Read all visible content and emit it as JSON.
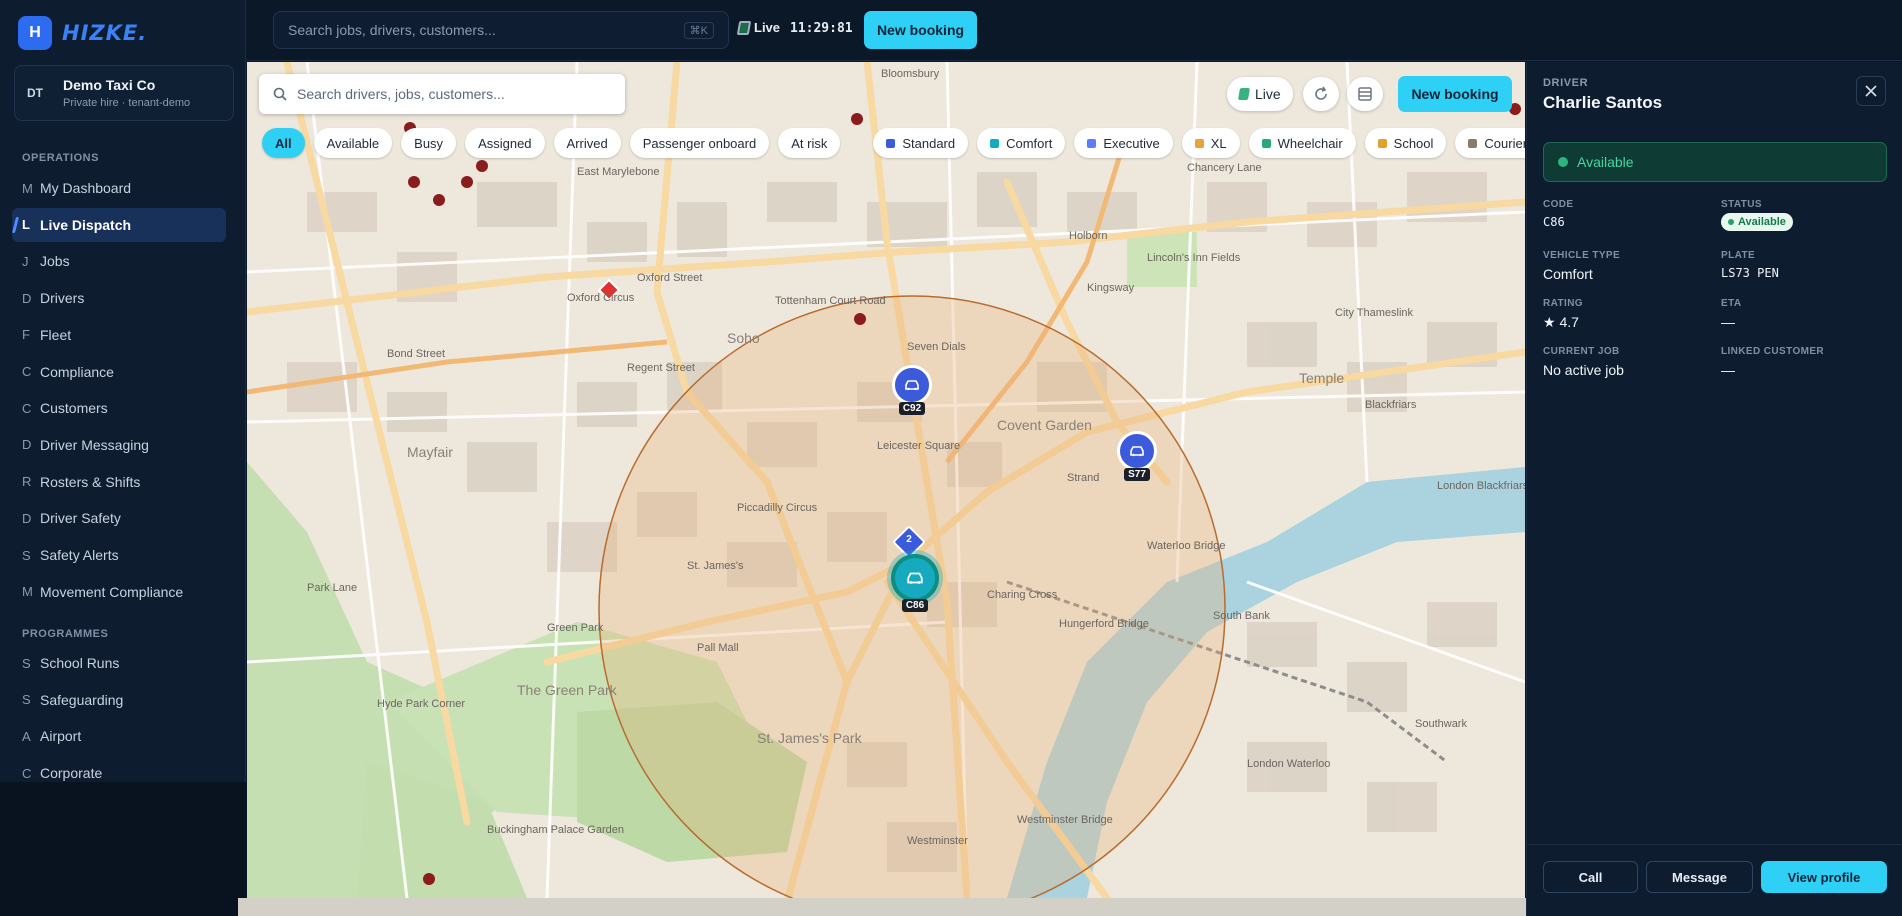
{
  "brand": {
    "mark": "H",
    "name": "HIZKE."
  },
  "tenant": {
    "initials": "DT",
    "name": "Demo Taxi Co",
    "subtitle": "Private hire · tenant-demo"
  },
  "nav": {
    "operations_label": "OPERATIONS",
    "operations": [
      {
        "letter": "M",
        "label": "My Dashboard"
      },
      {
        "letter": "L",
        "label": "Live Dispatch",
        "active": true
      },
      {
        "letter": "J",
        "label": "Jobs"
      },
      {
        "letter": "D",
        "label": "Drivers"
      },
      {
        "letter": "F",
        "label": "Fleet"
      },
      {
        "letter": "C",
        "label": "Compliance"
      },
      {
        "letter": "C",
        "label": "Customers"
      },
      {
        "letter": "D",
        "label": "Driver Messaging"
      },
      {
        "letter": "R",
        "label": "Rosters & Shifts"
      },
      {
        "letter": "D",
        "label": "Driver Safety"
      },
      {
        "letter": "S",
        "label": "Safety Alerts"
      },
      {
        "letter": "M",
        "label": "Movement Compliance"
      }
    ],
    "programmes_label": "PROGRAMMES",
    "programmes": [
      {
        "letter": "S",
        "label": "School Runs"
      },
      {
        "letter": "S",
        "label": "Safeguarding"
      },
      {
        "letter": "A",
        "label": "Airport"
      },
      {
        "letter": "C",
        "label": "Corporate"
      }
    ]
  },
  "topbar": {
    "search_placeholder": "Search jobs, drivers, customers...",
    "shortcut": "⌘K",
    "live_label": "Live",
    "clock": "11:29:81",
    "new_booking": "New booking"
  },
  "map": {
    "search_placeholder": "Search drivers, jobs, customers...",
    "live_label": "Live",
    "new_booking": "New booking",
    "status_filters": [
      "All",
      "Available",
      "Busy",
      "Assigned",
      "Arrived",
      "Passenger onboard",
      "At risk"
    ],
    "vehicle_filters": [
      {
        "label": "Standard",
        "color": "#3b5bdb"
      },
      {
        "label": "Comfort",
        "color": "#15aabf"
      },
      {
        "label": "Executive",
        "color": "#5c7cfa"
      },
      {
        "label": "XL",
        "color": "#e8a33a"
      },
      {
        "label": "Wheelchair",
        "color": "#2aa87a"
      },
      {
        "label": "School",
        "color": "#e0a22e"
      },
      {
        "label": "Courier",
        "color": "#8a7c6a"
      }
    ],
    "places": {
      "bloomsbury": "Bloomsbury",
      "east_marylebone": "East Marylebone",
      "oxford_circus": "Oxford Circus",
      "bond_street": "Bond Street",
      "mayfair": "Mayfair",
      "soho": "Soho",
      "tottenham": "Tottenham Court Road",
      "seven_dials": "Seven Dials",
      "covent_garden": "Covent Garden",
      "leicester_square": "Leicester Square",
      "piccadilly_circus": "Piccadilly Circus",
      "st_james": "St. James's",
      "green_park": "Green Park",
      "the_green_park": "The Green Park",
      "st_james_park": "St. James's Park",
      "buckingham": "Buckingham Palace Garden",
      "hyde_park_corner": "Hyde Park Corner",
      "charing_cross": "Charing Cross",
      "hungerford": "Hungerford Bridge",
      "waterloo_bridge": "Waterloo Bridge",
      "westminster": "Westminster",
      "westminster_bridge": "Westminster Bridge",
      "holborn": "Holborn",
      "chancery_lane": "Chancery Lane",
      "city_thameslink": "City Thameslink",
      "temple": "Temple",
      "blackfriars": "Blackfriars",
      "london_blackfriars": "London Blackfriars",
      "south_bank": "South Bank",
      "southwark": "Southwark",
      "waterloo": "London Waterloo",
      "lincolns_inn": "Lincoln's Inn Fields",
      "oxford_street": "Oxford Street",
      "strand": "Strand",
      "pall_mall": "Pall Mall",
      "park_lane": "Park Lane",
      "regent_street": "Regent Street",
      "kingsway": "Kingsway"
    },
    "vehicles": [
      {
        "code": "C92",
        "color": "#3b5bdb"
      },
      {
        "code": "S77",
        "color": "#3b5bdb"
      },
      {
        "code": "C86",
        "color": "#15aabf"
      }
    ],
    "customer_pin": "2"
  },
  "panel": {
    "kicker": "DRIVER",
    "name": "Charlie Santos",
    "status_banner": "Available",
    "fields": {
      "code_label": "CODE",
      "code": "C86",
      "status_label": "STATUS",
      "status": "Available",
      "vehicle_type_label": "VEHICLE TYPE",
      "vehicle_type": "Comfort",
      "plate_label": "PLATE",
      "plate": "LS73 PEN",
      "rating_label": "RATING",
      "rating": "★ 4.7",
      "eta_label": "ETA",
      "eta": "—",
      "current_job_label": "CURRENT JOB",
      "current_job": "No active job",
      "linked_customer_label": "LINKED CUSTOMER",
      "linked_customer": "—"
    },
    "actions": {
      "call": "Call",
      "message": "Message",
      "view_profile": "View profile"
    }
  },
  "colors": {
    "accent": "#2fd0f5",
    "brand": "#2d6cf0",
    "available": "#2fb47f"
  }
}
